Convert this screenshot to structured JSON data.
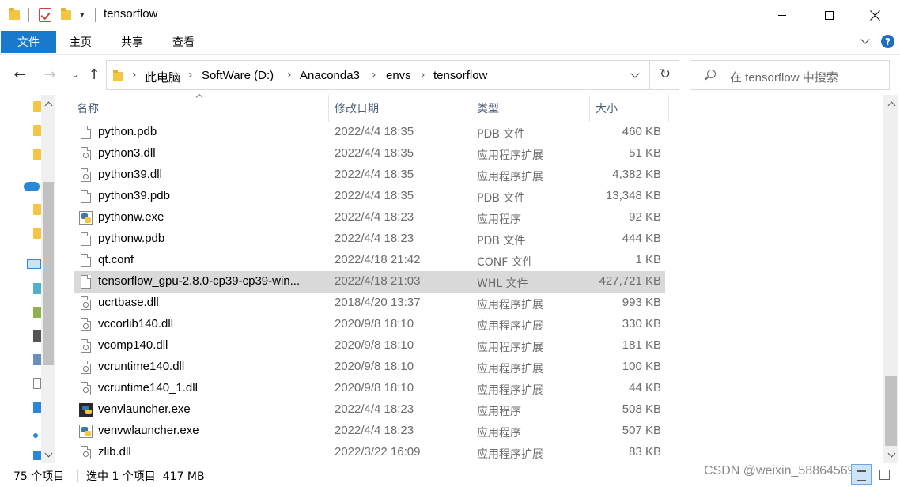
{
  "window": {
    "title": "tensorflow",
    "quick_access_dropdown": "▾"
  },
  "ribbon": {
    "tabs": [
      "文件",
      "主页",
      "共享",
      "查看"
    ],
    "help": "?"
  },
  "address": {
    "crumbs": [
      "此电脑",
      "SoftWare (D:)",
      "Anaconda3",
      "envs",
      "tensorflow"
    ],
    "separator": "›"
  },
  "search": {
    "placeholder": "在 tensorflow 中搜索"
  },
  "columns": {
    "name": "名称",
    "date": "修改日期",
    "type": "类型",
    "size": "大小"
  },
  "files": [
    {
      "name": "python.pdb",
      "date": "2022/4/4 18:35",
      "type": "PDB 文件",
      "size": "460 KB",
      "icon": "file-icon"
    },
    {
      "name": "python3.dll",
      "date": "2022/4/4 18:35",
      "type": "应用程序扩展",
      "size": "51 KB",
      "icon": "dll-icon"
    },
    {
      "name": "python39.dll",
      "date": "2022/4/4 18:35",
      "type": "应用程序扩展",
      "size": "4,382 KB",
      "icon": "dll-icon"
    },
    {
      "name": "python39.pdb",
      "date": "2022/4/4 18:35",
      "type": "PDB 文件",
      "size": "13,348 KB",
      "icon": "file-icon"
    },
    {
      "name": "pythonw.exe",
      "date": "2022/4/4 18:23",
      "type": "应用程序",
      "size": "92 KB",
      "icon": "python-exe-icon"
    },
    {
      "name": "pythonw.pdb",
      "date": "2022/4/4 18:23",
      "type": "PDB 文件",
      "size": "444 KB",
      "icon": "file-icon"
    },
    {
      "name": "qt.conf",
      "date": "2022/4/18 21:42",
      "type": "CONF 文件",
      "size": "1 KB",
      "icon": "file-icon"
    },
    {
      "name": "tensorflow_gpu-2.8.0-cp39-cp39-win...",
      "date": "2022/4/18 21:03",
      "type": "WHL 文件",
      "size": "427,721 KB",
      "icon": "file-icon",
      "selected": true
    },
    {
      "name": "ucrtbase.dll",
      "date": "2018/4/20 13:37",
      "type": "应用程序扩展",
      "size": "993 KB",
      "icon": "dll-icon"
    },
    {
      "name": "vccorlib140.dll",
      "date": "2020/9/8 18:10",
      "type": "应用程序扩展",
      "size": "330 KB",
      "icon": "dll-icon"
    },
    {
      "name": "vcomp140.dll",
      "date": "2020/9/8 18:10",
      "type": "应用程序扩展",
      "size": "181 KB",
      "icon": "dll-icon"
    },
    {
      "name": "vcruntime140.dll",
      "date": "2020/9/8 18:10",
      "type": "应用程序扩展",
      "size": "100 KB",
      "icon": "dll-icon"
    },
    {
      "name": "vcruntime140_1.dll",
      "date": "2020/9/8 18:10",
      "type": "应用程序扩展",
      "size": "44 KB",
      "icon": "dll-icon"
    },
    {
      "name": "venvlauncher.exe",
      "date": "2022/4/4 18:23",
      "type": "应用程序",
      "size": "508 KB",
      "icon": "venv-exe-icon"
    },
    {
      "name": "venvwlauncher.exe",
      "date": "2022/4/4 18:23",
      "type": "应用程序",
      "size": "507 KB",
      "icon": "python-exe-icon"
    },
    {
      "name": "zlib.dll",
      "date": "2022/3/22 16:09",
      "type": "应用程序扩展",
      "size": "83 KB",
      "icon": "dll-icon"
    }
  ],
  "status": {
    "item_count": "75 个项目",
    "selection": "选中 1 个项目  417 MB"
  },
  "watermark": "CSDN @weixin_58864569",
  "colors": {
    "accent": "#1979ca",
    "selected_row": "#d9d9d9",
    "column_header": "#4c607a"
  }
}
